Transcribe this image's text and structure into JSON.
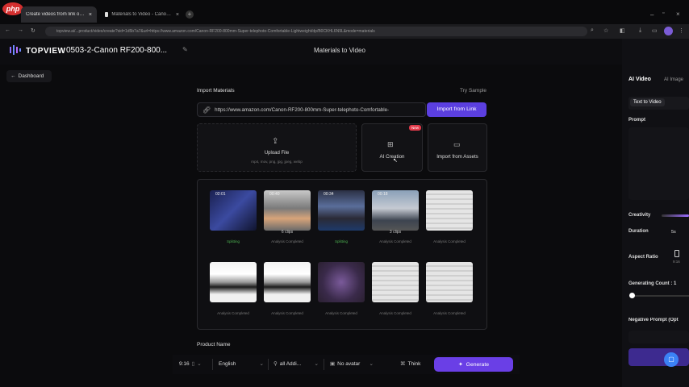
{
  "browser": {
    "php_logo": "php",
    "tabs": [
      {
        "label": "Create videos from link or script"
      },
      {
        "label": "Materials to Video - Canon RF200-800"
      }
    ],
    "url": "topview.ai/...product/video/create?sid=1d5b7a7&url=https://www.amazon.com/Canon-RF200-800mm-Super-telephoto-Comfortable-Lightweight/dp/B0CKHL6N9L&mode=materials"
  },
  "app": {
    "logo": "TOPVIEW",
    "project_title": "0503-2-Canon RF200-800...",
    "page_title": "Materials to Video",
    "dashboard": "Dashboard"
  },
  "import": {
    "section_label": "Import Materials",
    "try_sample": "Try Sample",
    "link_value": "https://www.amazon.com/Canon-RF200-800mm-Super-telephoto-Comfortable-",
    "import_button": "Import from Link",
    "upload_title": "Upload File",
    "upload_hint": "mp4, mov, png, jpg, jpeg, webp",
    "ai_creation": "AI Creation",
    "new_badge": "New",
    "import_assets": "Import from Assets"
  },
  "materials": [
    {
      "duration": "02:01",
      "clips": "",
      "status": "Splitting",
      "status_color": "#4caf50",
      "thumb": "dark-blue"
    },
    {
      "duration": "00:40",
      "clips": "6 clips",
      "status": "Analysis Completed",
      "status_color": "#777777",
      "thumb": "hand"
    },
    {
      "duration": "00:34",
      "clips": "",
      "status": "Splitting",
      "status_color": "#4caf50",
      "thumb": "road"
    },
    {
      "duration": "00:18",
      "clips": "3 clips",
      "status": "Analysis Completed",
      "status_color": "#777777",
      "thumb": "plane"
    },
    {
      "duration": "",
      "clips": "",
      "status": "Analysis Completed",
      "status_color": "#777777",
      "thumb": "document"
    },
    {
      "duration": "",
      "clips": "",
      "status": "Analysis Completed",
      "status_color": "#777777",
      "thumb": "lens"
    },
    {
      "duration": "",
      "clips": "",
      "status": "Analysis Completed",
      "status_color": "#777777",
      "thumb": "lens"
    },
    {
      "duration": "",
      "clips": "",
      "status": "Analysis Completed",
      "status_color": "#777777",
      "thumb": "purple"
    },
    {
      "duration": "",
      "clips": "",
      "status": "Analysis Completed",
      "status_color": "#777777",
      "thumb": "document"
    },
    {
      "duration": "",
      "clips": "",
      "status": "Analysis Completed",
      "status_color": "#777777",
      "thumb": "document"
    }
  ],
  "product_name_label": "Product Name",
  "bottom_bar": {
    "ratio": "9:16",
    "language": "English",
    "audience": "all Addi...",
    "avatar": "No avatar",
    "think": "Think",
    "generate": "Generate"
  },
  "right_panel": {
    "tab_ai_video": "AI Video",
    "tab_ai_image": "AI Image",
    "subtab": "Text to Video",
    "prompt_label": "Prompt",
    "creativity_label": "Creativity",
    "duration_label": "Duration",
    "duration_value": "5s",
    "aspect_label": "Aspect Ratio",
    "aspect_value": "9:16",
    "count_label": "Generating Count : 1",
    "negative_label": "Negative Prompt (Opt",
    "close": "×"
  },
  "colors": {
    "accent": "#5b3fe0",
    "generate": "#6a3fe6",
    "new_badge": "#e23a4a",
    "green": "#4caf50"
  }
}
